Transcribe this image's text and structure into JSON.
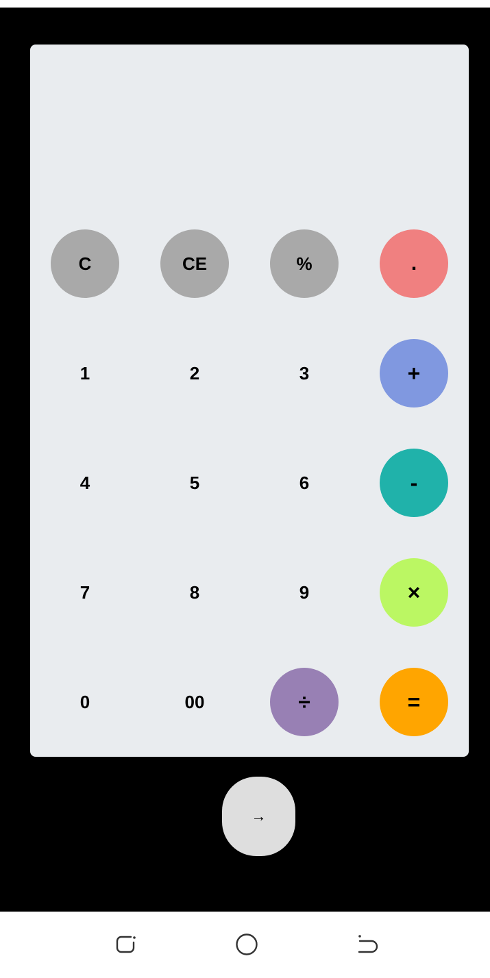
{
  "calculator": {
    "display": "",
    "keys": [
      {
        "label": "C",
        "name": "clear-button",
        "style": "gray"
      },
      {
        "label": "CE",
        "name": "clear-entry-button",
        "style": "gray"
      },
      {
        "label": "%",
        "name": "percent-button",
        "style": "gray"
      },
      {
        "label": ".",
        "name": "decimal-button",
        "color": "#f08080"
      },
      {
        "label": "1",
        "name": "digit-1-button",
        "style": "plain"
      },
      {
        "label": "2",
        "name": "digit-2-button",
        "style": "plain"
      },
      {
        "label": "3",
        "name": "digit-3-button",
        "style": "plain"
      },
      {
        "label": "+",
        "name": "add-button",
        "color": "#8098e0"
      },
      {
        "label": "4",
        "name": "digit-4-button",
        "style": "plain"
      },
      {
        "label": "5",
        "name": "digit-5-button",
        "style": "plain"
      },
      {
        "label": "6",
        "name": "digit-6-button",
        "style": "plain"
      },
      {
        "label": "-",
        "name": "subtract-button",
        "color": "#20b2aa"
      },
      {
        "label": "7",
        "name": "digit-7-button",
        "style": "plain"
      },
      {
        "label": "8",
        "name": "digit-8-button",
        "style": "plain"
      },
      {
        "label": "9",
        "name": "digit-9-button",
        "style": "plain"
      },
      {
        "label": "×",
        "name": "multiply-button",
        "color": "#bbf763"
      },
      {
        "label": "0",
        "name": "digit-0-button",
        "style": "plain"
      },
      {
        "label": "00",
        "name": "double-zero-button",
        "style": "plain"
      },
      {
        "label": "÷",
        "name": "divide-button",
        "color": "#9880b4"
      },
      {
        "label": "=",
        "name": "equals-button",
        "color": "#ffa500"
      }
    ]
  },
  "next_button": {
    "label": "→"
  },
  "navigation_bar": {
    "icons": [
      "recent-apps-icon",
      "home-icon",
      "back-icon"
    ]
  },
  "colors": {
    "screen_background": "#000000",
    "panel_background": "#e9ecef",
    "gray_key": "#a9a9a9",
    "next_button_background": "#dedede"
  }
}
